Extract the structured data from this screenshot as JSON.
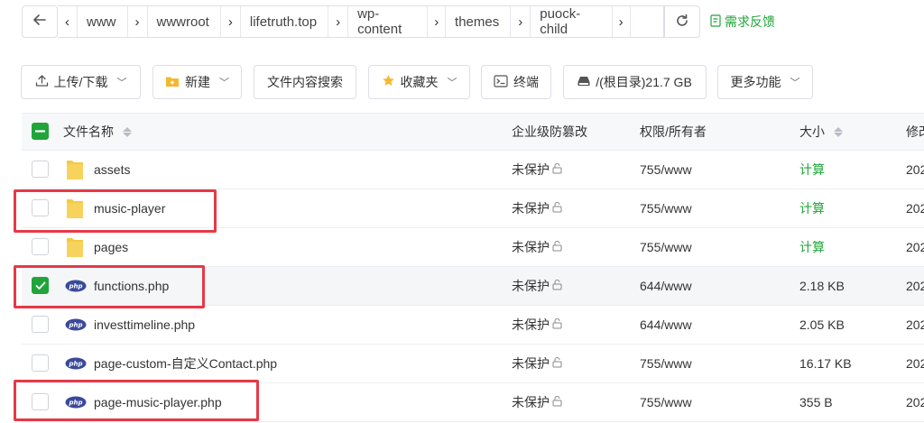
{
  "path": {
    "segments": [
      "www",
      "wwwroot",
      "lifetruth.top",
      "wp-content",
      "themes",
      "puock-child"
    ],
    "feedback_label": "需求反馈"
  },
  "toolbar": {
    "upload_label": "上传/下载",
    "new_label": "新建",
    "content_search_label": "文件内容搜索",
    "favorites_label": "收藏夹",
    "terminal_label": "终端",
    "disk_label": "/(根目录)21.7 GB",
    "more_label": "更多功能"
  },
  "table": {
    "headers": {
      "name": "文件名称",
      "tamper": "企业级防篡改",
      "perm": "权限/所有者",
      "size": "大小",
      "modified": "修改"
    },
    "rows": [
      {
        "type": "folder",
        "name": "assets",
        "tamper": "未保护",
        "perm": "755/www",
        "size": "计算",
        "modified": "202",
        "checked": false
      },
      {
        "type": "folder",
        "name": "music-player",
        "tamper": "未保护",
        "perm": "755/www",
        "size": "计算",
        "modified": "202",
        "checked": false
      },
      {
        "type": "folder",
        "name": "pages",
        "tamper": "未保护",
        "perm": "755/www",
        "size": "计算",
        "modified": "202",
        "checked": false
      },
      {
        "type": "php",
        "name": "functions.php",
        "tamper": "未保护",
        "perm": "644/www",
        "size": "2.18 KB",
        "modified": "202",
        "checked": true
      },
      {
        "type": "php",
        "name": "investtimeline.php",
        "tamper": "未保护",
        "perm": "644/www",
        "size": "2.05 KB",
        "modified": "202",
        "checked": false
      },
      {
        "type": "php",
        "name": "page-custom-自定义Contact.php",
        "tamper": "未保护",
        "perm": "755/www",
        "size": "16.17 KB",
        "modified": "202",
        "checked": false
      },
      {
        "type": "php",
        "name": "page-music-player.php",
        "tamper": "未保护",
        "perm": "755/www",
        "size": "355 B",
        "modified": "202",
        "checked": false
      }
    ]
  },
  "php_icon_text": "php",
  "colors": {
    "accent": "#20a53a",
    "highlight": "#e63946",
    "folder": "#f5c945",
    "php_icon": "#3a4a9a"
  }
}
